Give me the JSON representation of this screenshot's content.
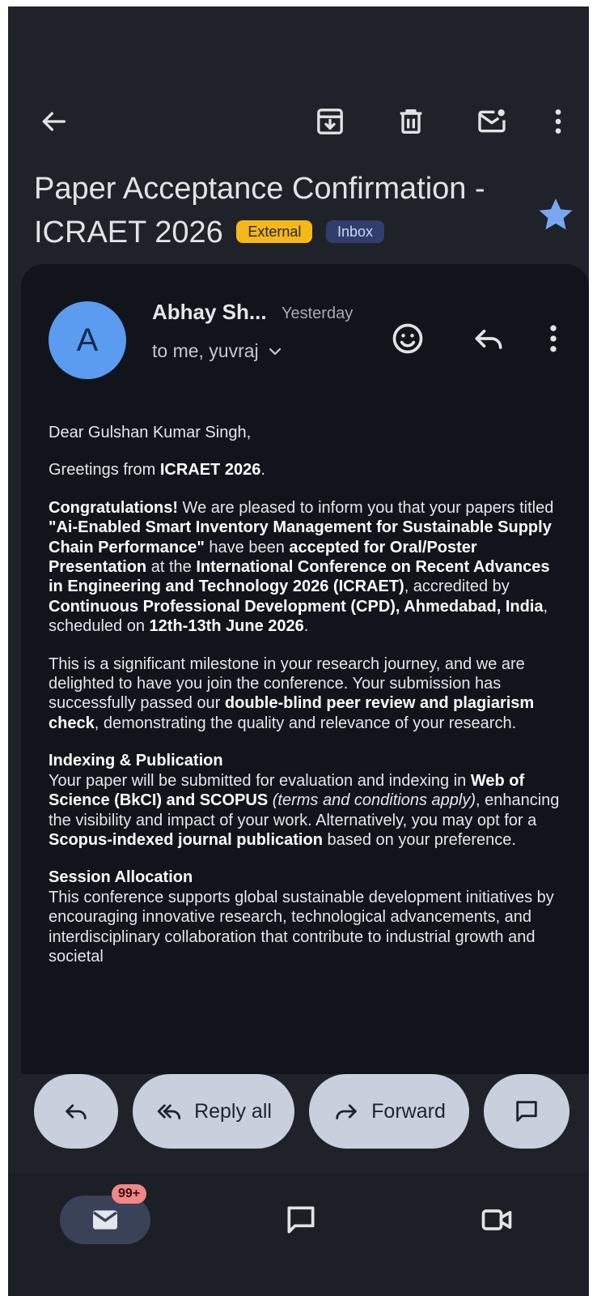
{
  "subject": {
    "title": "Paper Acceptance Confirmation - ICRAET 2026",
    "labels": [
      "External",
      "Inbox"
    ]
  },
  "message": {
    "avatar_initial": "A",
    "sender": "Abhay Sh...",
    "time": "Yesterday",
    "recipients": "to me, yuvraj",
    "greeting": "Dear Gulshan Kumar Singh,",
    "p1_a": "Greetings from ",
    "p1_b": "ICRAET 2026",
    "p1_c": ".",
    "p2_a": "Congratulations!",
    "p2_b": " We are pleased to inform you that your papers titled ",
    "p2_c": "\"Ai-Enabled Smart Inventory Management for Sustainable Supply Chain Performance\"",
    "p2_d": " have been ",
    "p2_e": "accepted for Oral/Poster Presentation",
    "p2_f": " at the ",
    "p2_g": "International Conference on Recent Advances in Engineering and Technology 2026 (ICRAET)",
    "p2_h": ", accredited by ",
    "p2_i": "Continuous Professional Development (CPD), Ahmedabad, India",
    "p2_j": ", scheduled on ",
    "p2_k": "12th-13th June 2026",
    "p2_l": ".",
    "p3_a": "This is a significant milestone in your research journey, and we are delighted to have you join the conference. Your submission has successfully passed our ",
    "p3_b": "double-blind peer review and plagiarism check",
    "p3_c": ", demonstrating the quality and relevance of your research.",
    "h4": "Indexing & Publication",
    "p4_a": "Your paper will be submitted for evaluation and indexing in ",
    "p4_b": "Web of Science (BkCI) and SCOPUS",
    "p4_c": " ",
    "p4_d": "(terms and conditions apply)",
    "p4_e": ", enhancing the visibility and impact of your work. Alternatively, you may opt for a ",
    "p4_f": "Scopus-indexed journal publication",
    "p4_g": " based on your preference.",
    "h5": "Session Allocation",
    "p5": "This conference supports global sustainable development initiatives by encouraging innovative research, technological advancements, and interdisciplinary collaboration that contribute to industrial growth and societal"
  },
  "actions": {
    "reply_all": "Reply all",
    "forward": "Forward"
  },
  "bottom_nav": {
    "mail_badge": "99+"
  },
  "icons": {
    "back": "arrow-left-icon",
    "archive": "archive-icon",
    "delete": "trash-icon",
    "unread": "mail-unread-icon",
    "more": "more-vert-icon",
    "star": "star-icon",
    "emoji": "emoji-icon",
    "reply": "reply-icon",
    "chat": "chat-icon",
    "meet": "video-icon"
  },
  "colors": {
    "background": "#1f2229",
    "card": "#11141a",
    "external_chip": "#f6b818",
    "inbox_chip": "#2f3e6b",
    "avatar": "#5b9bf0",
    "star": "#7aa7f2",
    "pill": "#c9cfdc",
    "badge": "#f08787"
  }
}
